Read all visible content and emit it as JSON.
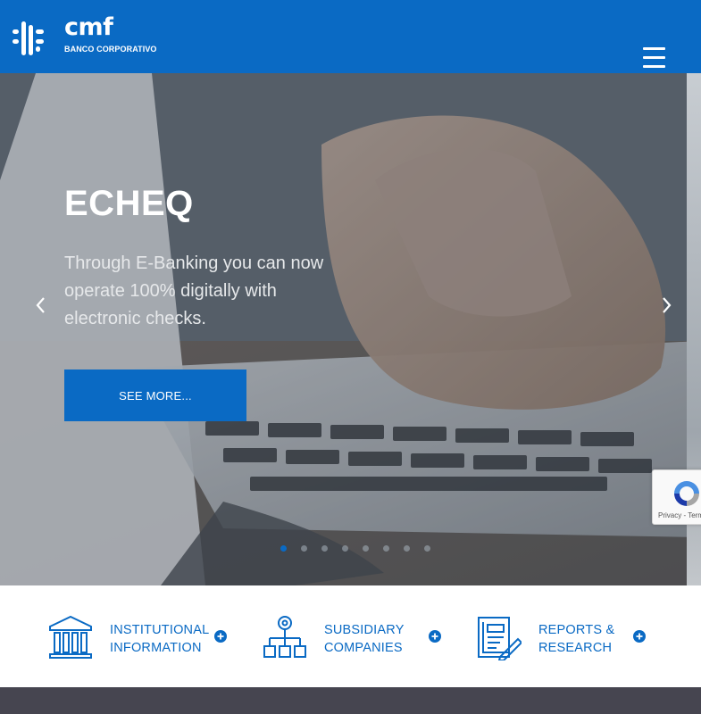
{
  "brand": {
    "name": "cmf",
    "subtitle": "BANCO CORPORATIVO",
    "color": "#0a6ac4"
  },
  "header": {
    "menu_icon": "hamburger-menu-icon"
  },
  "hero": {
    "title": "ECHEQ",
    "description": "Through E-Banking you can now operate 100% digitally with electronic checks.",
    "cta_label": "SEE MORE...",
    "prev_icon": "chevron-left-icon",
    "next_icon": "chevron-right-icon",
    "slides_total": 8,
    "active_slide": 1
  },
  "recaptcha": {
    "text": "Privacy - Terms"
  },
  "quick_links": [
    {
      "line1": "INSTITUTIONAL",
      "line2": "INFORMATION",
      "icon": "bank-building-icon"
    },
    {
      "line1": "SUBSIDIARY",
      "line2": "COMPANIES",
      "icon": "org-chart-icon"
    },
    {
      "line1": "REPORTS &",
      "line2": "RESEARCH",
      "icon": "report-document-icon"
    }
  ]
}
